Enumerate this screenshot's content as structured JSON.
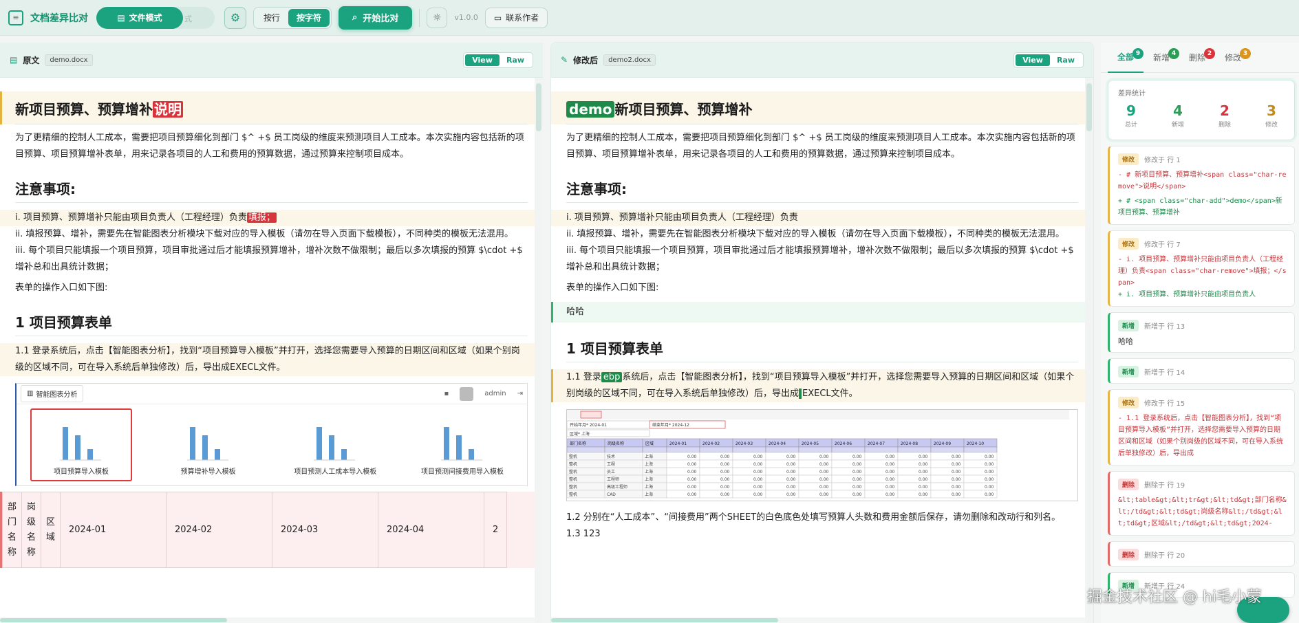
{
  "app": {
    "title": "文档差异比对",
    "mode_active": "文件模式",
    "mode_ghost": "式",
    "granularity": [
      "按行",
      "按字符"
    ],
    "compare_button": "开始比对",
    "version": "v1.0.0",
    "contact_button": "联系作者"
  },
  "left_pane": {
    "title": "原文",
    "file": "demo.docx",
    "view_label": "View",
    "raw_label": "Raw",
    "doc": {
      "h1_text": "新项目预算、预算增补",
      "h1_removed": "说明",
      "intro": "为了更精细的控制人工成本，需要把项目预算细化到部门 $^ +$ 员工岗级的维度来预测项目人工成本。本次实施内容包括新的项目预算、项目预算增补表单，用来记录各项目的人工和费用的预算数据，通过预算来控制项目成本。",
      "h2_notes": "注意事项:",
      "item1_text": "i. 项目预算、预算增补只能由项目负责人（工程经理）负责",
      "item1_removed": "填报；",
      "item2": "ii. 填报预算、增补，需要先在智能图表分析模块下载对应的导入模板（请勿在导入页面下载模板），不同种类的模板无法混用。",
      "item3": "iii. 每个项目只能填报一个项目预算，项目审批通过后才能填报预算增补，增补次数不做限制；最后以多次填报的预算 $\\cdot +$ 增补总和出具统计数据；",
      "entry": "表单的操作入口如下图:",
      "h2_section1": "1 项目预算表单",
      "step11": "1.1 登录系统后，点击【智能图表分析】，找到“项目预算导入模板”并打开，选择您需要导入预算的日期区间和区域（如果个别岗级的区域不同，可在导入系统后单独修改）后，导出成EXECL文件。"
    },
    "screenshot": {
      "tab_label": "智能图表分析",
      "user": "admin",
      "tiles": [
        "项目预算导入模板",
        "预算增补导入模板",
        "项目预测人工成本导入模板",
        "项目预测间接费用导入模板"
      ]
    },
    "table": {
      "headers": [
        "部门名称",
        "岗级名称",
        "区域"
      ],
      "months": [
        "2024-01",
        "2024-02",
        "2024-03",
        "2024-04",
        "2"
      ]
    }
  },
  "right_pane": {
    "title": "修改后",
    "file": "demo2.docx",
    "view_label": "View",
    "raw_label": "Raw",
    "doc": {
      "h1_added": "demo",
      "h1_text": "新项目预算、预算增补",
      "intro": "为了更精细的控制人工成本，需要把项目预算细化到部门 $^ +$ 员工岗级的维度来预测项目人工成本。本次实施内容包括新的项目预算、项目预算增补表单，用来记录各项目的人工和费用的预算数据，通过预算来控制项目成本。",
      "h2_notes": "注意事项:",
      "item1": "i. 项目预算、预算增补只能由项目负责人（工程经理）负责",
      "item2": "ii. 填报预算、增补，需要先在智能图表分析模块下载对应的导入模板（请勿在导入页面下载模板），不同种类的模板无法混用。",
      "item3": "iii. 每个项目只能填报一个项目预算，项目审批通过后才能填报预算增补，增补次数不做限制；最后以多次填报的预算 $\\cdot +$ 增补总和出具统计数据；",
      "entry": "表单的操作入口如下图:",
      "added_line": "哈哈",
      "h2_section1": "1 项目预算表单",
      "step11_a": "1.1 登录",
      "step11_added": "ebp",
      "step11_b": "系统后，点击【智能图表分析】，找到“项目预算导入模板”并打开，选择您需要导入预算的日期区间和区域（如果个别岗级的区域不同，可在导入系统后单独修改）后，导出成",
      "step11_c": "EXECL文件。",
      "step12": "1.2 分别在“人工成本”、“间接费用”两个SHEET的白色底色处填写预算人头数和费用金额后保存，请勿删除和改动行和列名。",
      "step13": "1.3 123"
    },
    "excel": {
      "field1_label": "开始年月",
      "field1_value": "2024-01",
      "field2_label": "结束年月",
      "field2_value": "2024-12",
      "area_label": "区域",
      "area_value": "上海",
      "col_headers": [
        "部门名称",
        "岗级名称",
        "区域",
        "2024-01",
        "2024-02",
        "2024-03",
        "2024-04",
        "2024-05",
        "2024-06",
        "2024-07",
        "2024-08",
        "2024-09",
        "2024-10"
      ],
      "rows": [
        [
          "整机",
          "技术",
          "上海"
        ],
        [
          "整机",
          "工程",
          "上海"
        ],
        [
          "整机",
          "员工",
          "上海"
        ],
        [
          "整机",
          "工程师",
          "上海"
        ],
        [
          "整机",
          "高级工程师",
          "上海"
        ],
        [
          "整机",
          "CAD",
          "上海"
        ]
      ],
      "cell_value": "0.00"
    }
  },
  "sidebar": {
    "tabs": [
      {
        "label": "全部",
        "count": "9",
        "color": "#1ba27f"
      },
      {
        "label": "新增",
        "count": "4",
        "color": "#2a9d57"
      },
      {
        "label": "删除",
        "count": "2",
        "color": "#d9333b"
      },
      {
        "label": "修改",
        "count": "3",
        "color": "#d9951c"
      }
    ],
    "stats": {
      "title": "差异统计",
      "items": [
        {
          "num": "9",
          "label": "总计",
          "color": "#1ba27f"
        },
        {
          "num": "4",
          "label": "新增",
          "color": "#2a9d57"
        },
        {
          "num": "2",
          "label": "删除",
          "color": "#d9333b"
        },
        {
          "num": "3",
          "label": "修改",
          "color": "#c58b17"
        }
      ]
    },
    "cards": [
      {
        "type": "修改",
        "where": "修改于 行 1",
        "minus": "- # 新项目预算、预算增补<span class=\"char-remove\">说明</span>",
        "plus": "+ # <span class=\"char-add\">demo</span>新项目预算、预算增补"
      },
      {
        "type": "修改",
        "where": "修改于 行 7",
        "minus": "- i. 项目预算、预算增补只能由项目负责人（工程经理）负责<span class=\"char-remove\">填报；</span>",
        "plus": "+ i. 项目预算、预算增补只能由项目负责人"
      },
      {
        "type": "新增",
        "where": "新增于 行 13",
        "text": "哈哈"
      },
      {
        "type": "新增",
        "where": "新增于 行 14",
        "text": ""
      },
      {
        "type": "修改",
        "where": "修改于 行 15",
        "minus": "- 1.1 登录系统后，点击【智能图表分析】，找到“项目预算导入模板”并打开，选择您需要导入预算的日期区间和区域（如果个别岗级的区域不同，可在导入系统后单独修改）后，导出成",
        "plus": ""
      },
      {
        "type": "删除",
        "where": "删除于 行 19",
        "text": "&lt;table&gt;&lt;tr&gt;&lt;td&gt;部门名称&lt;/td&gt;&lt;td&gt;岗级名称&lt;/td&gt;&lt;td&gt;区域&lt;/td&gt;&lt;td&gt;2024-"
      },
      {
        "type": "删除",
        "where": "删除于 行 20",
        "text": ""
      },
      {
        "type": "新增",
        "where": "新增于 行 24",
        "text": ""
      }
    ]
  },
  "watermark": "掘金技术社区 @ hi毛小蒙",
  "colors": {
    "accent": "#1ba27f",
    "add": "#1e8b4a",
    "remove": "#d9333b",
    "modify": "#e4b23f"
  }
}
